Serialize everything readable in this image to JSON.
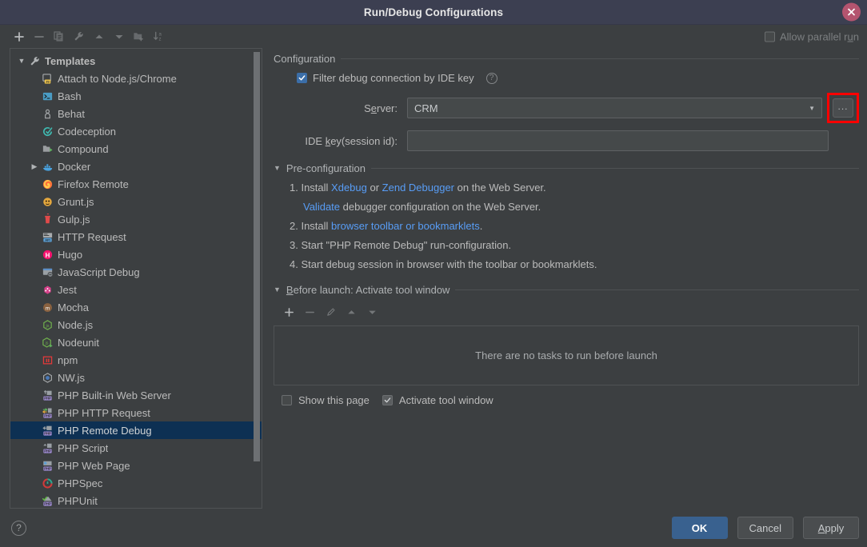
{
  "window": {
    "title": "Run/Debug Configurations",
    "close_icon": "close-icon"
  },
  "toolbar": {
    "buttons": [
      {
        "name": "add-configuration-button",
        "icon": "plus-icon",
        "enabled": true
      },
      {
        "name": "remove-configuration-button",
        "icon": "minus-icon",
        "enabled": false
      },
      {
        "name": "copy-configuration-button",
        "icon": "copy-icon",
        "enabled": false
      },
      {
        "name": "edit-templates-button",
        "icon": "wrench-icon",
        "enabled": false
      },
      {
        "name": "move-up-button",
        "icon": "arrow-up-icon",
        "enabled": false
      },
      {
        "name": "move-down-button",
        "icon": "arrow-down-icon",
        "enabled": false
      },
      {
        "name": "create-folder-button",
        "icon": "folder-add-icon",
        "enabled": false
      },
      {
        "name": "sort-configurations-button",
        "icon": "sort-az-icon",
        "enabled": false
      }
    ]
  },
  "allow_parallel": {
    "label_before": "Allow parallel r",
    "label_mnemonic": "u",
    "label_after": "n",
    "checked": false
  },
  "tree": {
    "root": {
      "label": "Templates",
      "icon": "wrench-icon",
      "expanded": true
    },
    "items": [
      {
        "label": "Attach to Node.js/Chrome",
        "icon": "nodejs-chrome-icon",
        "expandable": false,
        "selected": false
      },
      {
        "label": "Bash",
        "icon": "bash-terminal-icon",
        "expandable": false,
        "selected": false
      },
      {
        "label": "Behat",
        "icon": "behat-icon",
        "expandable": false,
        "selected": false
      },
      {
        "label": "Codeception",
        "icon": "codeception-icon",
        "expandable": false,
        "selected": false
      },
      {
        "label": "Compound",
        "icon": "compound-icon",
        "expandable": false,
        "selected": false
      },
      {
        "label": "Docker",
        "icon": "docker-icon",
        "expandable": true,
        "selected": false
      },
      {
        "label": "Firefox Remote",
        "icon": "firefox-icon",
        "expandable": false,
        "selected": false
      },
      {
        "label": "Grunt.js",
        "icon": "grunt-icon",
        "expandable": false,
        "selected": false
      },
      {
        "label": "Gulp.js",
        "icon": "gulp-icon",
        "expandable": false,
        "selected": false
      },
      {
        "label": "HTTP Request",
        "icon": "http-request-icon",
        "expandable": false,
        "selected": false
      },
      {
        "label": "Hugo",
        "icon": "hugo-icon",
        "expandable": false,
        "selected": false
      },
      {
        "label": "JavaScript Debug",
        "icon": "javascript-debug-icon",
        "expandable": false,
        "selected": false
      },
      {
        "label": "Jest",
        "icon": "jest-icon",
        "expandable": false,
        "selected": false
      },
      {
        "label": "Mocha",
        "icon": "mocha-icon",
        "expandable": false,
        "selected": false
      },
      {
        "label": "Node.js",
        "icon": "nodejs-icon",
        "expandable": false,
        "selected": false
      },
      {
        "label": "Nodeunit",
        "icon": "nodeunit-icon",
        "expandable": false,
        "selected": false
      },
      {
        "label": "npm",
        "icon": "npm-icon",
        "expandable": false,
        "selected": false
      },
      {
        "label": "NW.js",
        "icon": "nwjs-icon",
        "expandable": false,
        "selected": false
      },
      {
        "label": "PHP Built-in Web Server",
        "icon": "php-builtin-server-icon",
        "expandable": false,
        "selected": false
      },
      {
        "label": "PHP HTTP Request",
        "icon": "php-http-request-icon",
        "expandable": false,
        "selected": false
      },
      {
        "label": "PHP Remote Debug",
        "icon": "php-remote-debug-icon",
        "expandable": false,
        "selected": true
      },
      {
        "label": "PHP Script",
        "icon": "php-script-icon",
        "expandable": false,
        "selected": false
      },
      {
        "label": "PHP Web Page",
        "icon": "php-web-page-icon",
        "expandable": false,
        "selected": false
      },
      {
        "label": "PHPSpec",
        "icon": "phpspec-icon",
        "expandable": false,
        "selected": false
      },
      {
        "label": "PHPUnit",
        "icon": "phpunit-icon",
        "expandable": false,
        "selected": false
      }
    ]
  },
  "configuration": {
    "section_title": "Configuration",
    "filter_checkbox": {
      "label": "Filter debug connection by IDE key",
      "checked": true,
      "help_icon": "question-icon"
    },
    "server": {
      "label_before": "S",
      "label_mnemonic": "e",
      "label_after": "rver:",
      "value": "CRM",
      "dropdown_icon": "chevron-down-icon",
      "browse_button": {
        "label": "...",
        "highlight_color": "#ff0000"
      }
    },
    "ide_key": {
      "label_before": "IDE ",
      "label_mnemonic": "k",
      "label_after": "ey(session id):",
      "value": "",
      "placeholder": ""
    }
  },
  "pre_configuration": {
    "section_title": "Pre-configuration",
    "steps": [
      {
        "number": "1.",
        "parts": [
          {
            "t": "Install ",
            "link": false
          },
          {
            "t": "Xdebug",
            "link": true
          },
          {
            "t": " or ",
            "link": false
          },
          {
            "t": "Zend Debugger",
            "link": true
          },
          {
            "t": " on the Web Server.",
            "link": false
          }
        ],
        "sub": false
      },
      {
        "number": "",
        "parts": [
          {
            "t": "Validate",
            "link": true
          },
          {
            "t": " debugger configuration on the Web Server.",
            "link": false
          }
        ],
        "sub": true
      },
      {
        "number": "2.",
        "parts": [
          {
            "t": "Install ",
            "link": false
          },
          {
            "t": "browser toolbar or bookmarklets",
            "link": true
          },
          {
            "t": ".",
            "link": false
          }
        ],
        "sub": false
      },
      {
        "number": "3.",
        "parts": [
          {
            "t": "Start \"PHP Remote Debug\" run-configuration.",
            "link": false
          }
        ],
        "sub": false
      },
      {
        "number": "4.",
        "parts": [
          {
            "t": "Start debug session in browser with the toolbar or bookmarklets.",
            "link": false
          }
        ],
        "sub": false
      }
    ]
  },
  "before_launch": {
    "section_title_before": "B",
    "section_title_mnemonic": "e",
    "section_title_after": "fore launch: Activate tool window",
    "toolbar": [
      {
        "name": "add-task-button",
        "icon": "plus-icon",
        "enabled": true
      },
      {
        "name": "remove-task-button",
        "icon": "minus-icon",
        "enabled": false
      },
      {
        "name": "edit-task-button",
        "icon": "pencil-icon",
        "enabled": false
      },
      {
        "name": "move-task-up-button",
        "icon": "arrow-up-icon",
        "enabled": false
      },
      {
        "name": "move-task-down-button",
        "icon": "arrow-down-icon",
        "enabled": false
      }
    ],
    "empty_text": "There are no tasks to run before launch",
    "show_this_page": {
      "label": "Show this page",
      "checked": false
    },
    "activate_tool_window": {
      "label": "Activate tool window",
      "checked": true
    }
  },
  "footer": {
    "help_icon": "question-mark-icon",
    "ok": "OK",
    "cancel": "Cancel",
    "apply_before": "A",
    "apply_mnemonic": "p",
    "apply_after": "ply"
  }
}
